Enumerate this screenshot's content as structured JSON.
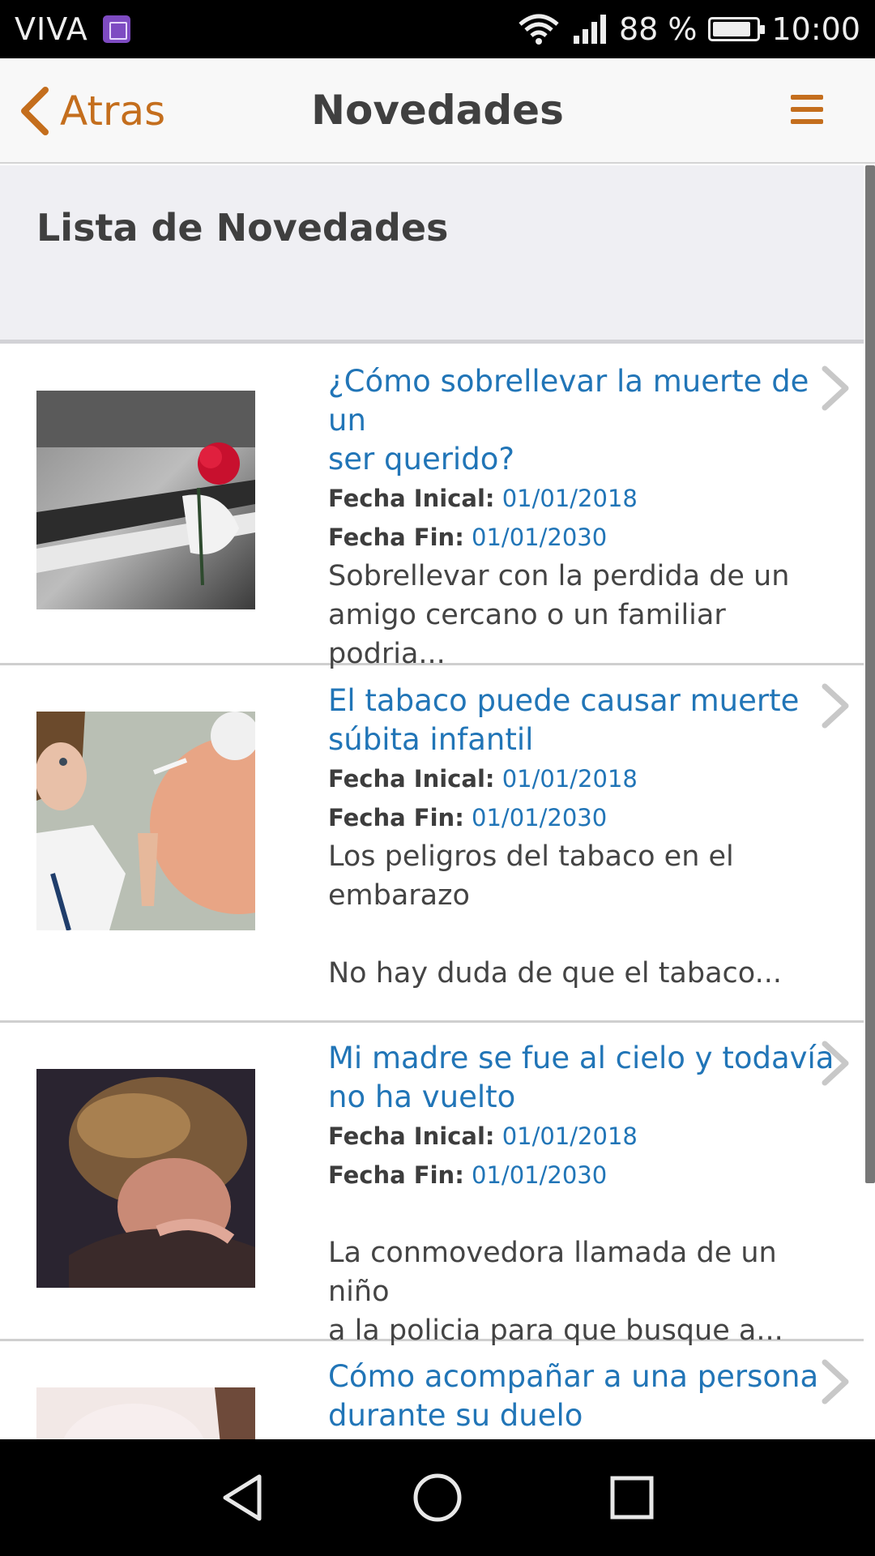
{
  "status_bar": {
    "carrier": "VIVA",
    "battery_text": "88 %",
    "battery_level": 0.88,
    "time": "10:00"
  },
  "header": {
    "back_label": "Atras",
    "title": "Novedades"
  },
  "section": {
    "title": "Lista de Novedades"
  },
  "labels": {
    "start": "Fecha Inical:",
    "end": "Fecha Fin:"
  },
  "items": [
    {
      "title_lines": [
        "¿Cómo sobrellevar la muerte de un",
        "ser querido?"
      ],
      "start": "01/01/2018",
      "end": "01/01/2030",
      "excerpt_lines": [
        "Sobrellevar con la perdida de un",
        "amigo cercano o un familiar",
        "podria..."
      ]
    },
    {
      "title_lines": [
        "El tabaco puede causar muerte",
        "súbita infantil"
      ],
      "start": "01/01/2018",
      "end": "01/01/2030",
      "excerpt_lines": [
        "Los peligros del tabaco en el",
        "embarazo",
        "",
        "No hay duda de que el tabaco..."
      ]
    },
    {
      "title_lines": [
        "Mi madre se fue al cielo y todavía",
        "no ha vuelto"
      ],
      "start": "01/01/2018",
      "end": "01/01/2030",
      "excerpt_lines": [
        "",
        "La conmovedora llamada de un niño",
        "a la policia para que busque a..."
      ]
    },
    {
      "title_lines": [
        "Cómo acompañar a una persona",
        "durante su duelo"
      ]
    }
  ],
  "colors": {
    "accent": "#c46e1d",
    "link": "#2175b7"
  },
  "icons": {
    "back": "chevron-left-icon",
    "menu": "hamburger-menu-icon",
    "item_arrow": "chevron-right-icon",
    "nav_back": "triangle-back-icon",
    "nav_home": "circle-home-icon",
    "nav_recents": "square-recents-icon"
  }
}
